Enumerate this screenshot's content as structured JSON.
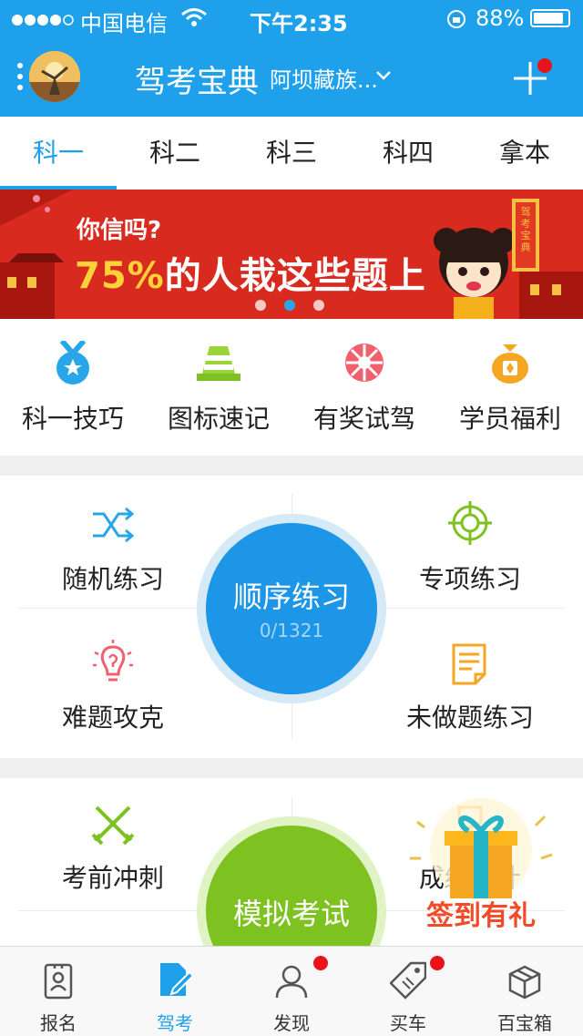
{
  "status_bar": {
    "carrier": "中国电信",
    "time": "下午2:35",
    "battery": "88%",
    "battery_level": 0.88
  },
  "header": {
    "app_title": "驾考宝典",
    "location": "阿坝藏族..."
  },
  "tabs": [
    {
      "label": "科一",
      "active": true
    },
    {
      "label": "科二",
      "active": false
    },
    {
      "label": "科三",
      "active": false
    },
    {
      "label": "科四",
      "active": false
    },
    {
      "label": "拿本",
      "active": false
    }
  ],
  "banner": {
    "line1": "你信吗?",
    "line2": "75%的人栽这些题上",
    "page_count": 3,
    "active_page": 2,
    "side_text": "驾考宝典"
  },
  "quick_links": [
    {
      "label": "科一技巧",
      "icon": "medal-icon"
    },
    {
      "label": "图标速记",
      "icon": "traffic-cone-icon"
    },
    {
      "label": "有奖试驾",
      "icon": "steering-wheel-icon"
    },
    {
      "label": "学员福利",
      "icon": "gift-bag-icon"
    }
  ],
  "practice": {
    "random": "随机练习",
    "special": "专项练习",
    "hard": "难题攻克",
    "undone": "未做题练习",
    "sequential": "顺序练习",
    "progress": "0/1321"
  },
  "exam": {
    "sprint": "考前冲刺",
    "mock": "模拟考试",
    "score": "成绩统计",
    "signin": "签到有礼"
  },
  "bottom_nav": [
    {
      "label": "报名",
      "icon": "id-card-icon",
      "active": false,
      "dot": false
    },
    {
      "label": "驾考",
      "icon": "edit-doc-icon",
      "active": true,
      "dot": false
    },
    {
      "label": "发现",
      "icon": "person-icon",
      "active": false,
      "dot": true
    },
    {
      "label": "买车",
      "icon": "tag-icon",
      "active": false,
      "dot": true
    },
    {
      "label": "百宝箱",
      "icon": "box-icon",
      "active": false,
      "dot": false
    }
  ],
  "colors": {
    "brand": "#1ea0ea",
    "banner_red": "#d92a1f",
    "mock_green": "#7dc220"
  }
}
